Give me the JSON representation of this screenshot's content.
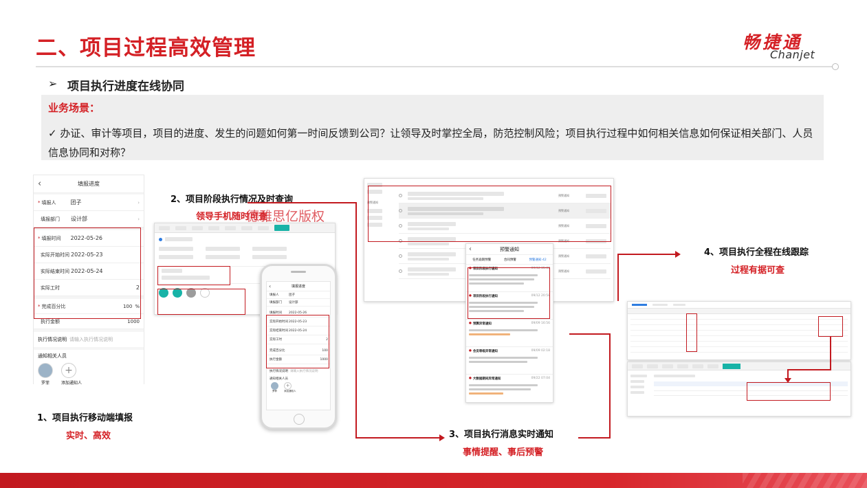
{
  "header": {
    "title": "二、项目过程高效管理",
    "logo_cn": "畅捷通",
    "logo_en": "Chanjet"
  },
  "section": {
    "arrow": "➢",
    "subtitle": "项目执行进度在线协同",
    "scene_label": "业务场景：",
    "scene_text": "✓ 办证、审计等项目，项目的进度、发生的问题如何第一时间反馈到公司？让领导及时掌控全局，防范控制风险；项目执行过程中如何相关信息如何保证相关部门、人员信息协同和对称？"
  },
  "mobile_form": {
    "title": "填报进度",
    "rows": [
      {
        "label": "填报人",
        "value": "团子",
        "required": true
      },
      {
        "label": "填报部门",
        "value": "设计部",
        "required": false
      },
      {
        "label": "填报时间",
        "value": "2022-05-26",
        "required": true
      },
      {
        "label": "实际开始时间",
        "value": "2022-05-23",
        "required": false
      },
      {
        "label": "实际结束时间",
        "value": "2022-05-24",
        "required": false
      },
      {
        "label": "实际工时",
        "value": "2",
        "required": false
      },
      {
        "label": "完成百分比",
        "value": "100",
        "unit": "%",
        "required": true
      },
      {
        "label": "执行金额",
        "value": "1000",
        "required": false
      }
    ],
    "desc_label": "执行情况说明",
    "desc_placeholder": "请输入执行情况说明",
    "notify_label": "通知相关人员",
    "person_name": "罗菲",
    "add_label": "添加通知人"
  },
  "phone": {
    "title": "填报进度",
    "rows": [
      {
        "label": "填报人",
        "value": "团子"
      },
      {
        "label": "填报部门",
        "value": "设计部"
      },
      {
        "label": "填报时间",
        "value": "2022-05-26"
      },
      {
        "label": "实际开始时间",
        "value": "2022-05-23"
      },
      {
        "label": "实际结束时间",
        "value": "2022-05-24"
      },
      {
        "label": "实际工时",
        "value": "2"
      },
      {
        "label": "完成百分比",
        "value": "100"
      },
      {
        "label": "执行金额",
        "value": "1000"
      }
    ],
    "desc_label": "执行情况说明",
    "desc_placeholder": "请输入执行情况说明",
    "notify_label": "通知相关人员",
    "person_name": "罗菲",
    "add_label": "添加通知人"
  },
  "notice_panel": {
    "title": "预警通知",
    "tabs": [
      "任务逾期预警",
      "合同预警",
      "预警通知"
    ],
    "badge": "42",
    "items": [
      {
        "title": "项目阶段执行通知",
        "date": "09/12 15:08"
      },
      {
        "title": "项目阶段执行通知",
        "date": "09/12 20:58"
      },
      {
        "title": "预算异常通知",
        "date": "09/09 16:56"
      },
      {
        "title": "会员等级异常通知",
        "date": "09/09 02:18"
      },
      {
        "title": "大数据期间异常通知",
        "date": "09/22 07:04"
      }
    ]
  },
  "web_list": {
    "side_label": "预警通知",
    "row_type": "预警通知"
  },
  "steps": {
    "s1_title": "1、项目执行移动端填报",
    "s1_sub": "实时、高效",
    "s2_title": "2、项目阶段执行情况及时查询",
    "s2_sub": "领导手机随时可查",
    "s3_title": "3、项目执行消息实时通知",
    "s3_sub": "事情提醒、事后预警",
    "s4_title": "4、项目执行全程在线跟踪",
    "s4_sub": "过程有据可查"
  },
  "watermark": "德雅思亿版权",
  "colors": {
    "accent_red": "#d42025",
    "box_red": "#c2191f",
    "scene_bg": "#eeeeee",
    "teal": "#18b3a7",
    "blue": "#2f7de1"
  }
}
